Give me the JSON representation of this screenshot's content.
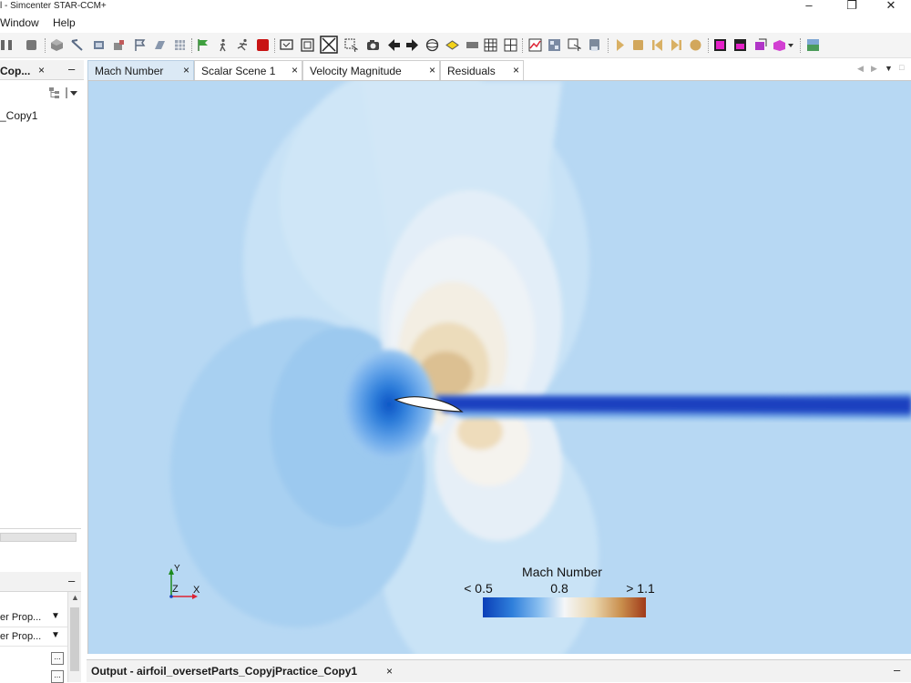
{
  "window": {
    "title": "l - Simcenter STAR-CCM+",
    "minimize_glyph": "–",
    "restore_glyph": "❐",
    "close_glyph": "✕"
  },
  "menu": {
    "items": [
      "Window",
      "Help"
    ]
  },
  "toolbar": {
    "icons": [
      "pause-icon",
      "stop-icon",
      "mesh-icon",
      "probe-icon",
      "region-icon",
      "boundary-icon",
      "flag-icon",
      "part-icon",
      "grid-icon",
      "flag-green-icon",
      "walk-icon",
      "run-icon",
      "stop-red-icon",
      "screen-icon",
      "fit-icon",
      "zoom-fit-icon",
      "select-icon",
      "camera-icon",
      "arrow-left-icon",
      "arrow-right-icon",
      "sphere-icon",
      "plane-icon",
      "ruler-icon",
      "table-icon",
      "table2-icon",
      "graph-icon",
      "windows-icon",
      "copy-icon",
      "save-icon",
      "play-icon",
      "square-icon",
      "step-back-icon",
      "step-fwd-icon",
      "record-icon",
      "scene-icon",
      "scene2-icon",
      "export-icon",
      "3d-icon",
      "view-icon"
    ]
  },
  "left_panel": {
    "title": "Cop...",
    "close_glyph": "×",
    "minimize_glyph": "–",
    "tree_item": "_Copy1",
    "bottom_minimize_glyph": "–",
    "properties": [
      {
        "label": "er Prop...",
        "dropdown": "▼"
      },
      {
        "label": "er Prop...",
        "dropdown": "▼"
      }
    ],
    "ellipsis": "..."
  },
  "tabs": [
    {
      "label": "Mach Number",
      "close": "×",
      "active": true
    },
    {
      "label": "Scalar Scene 1",
      "close": "×",
      "active": false
    },
    {
      "label": "Velocity Magnitude",
      "close": "×",
      "active": false
    },
    {
      "label": "Residuals",
      "close": "×",
      "active": false
    }
  ],
  "tab_nav": {
    "prev": "◀",
    "next": "▶",
    "menu": "▼",
    "max": "□"
  },
  "scene": {
    "axes": {
      "y": "Y",
      "z": "Z",
      "x": "X"
    },
    "legend": {
      "title": "Mach Number",
      "min_label": "< 0.5",
      "mid_label": "0.8",
      "max_label": "> 1.1"
    },
    "colors": {
      "background": "#b7d8f3",
      "wake": "#1f3fbf",
      "low_mach": "#0b52c4",
      "high_mach": "#d9b887",
      "airfoil": "#ffffff"
    }
  },
  "output": {
    "title": "Output - airfoil_oversetParts_CopyjPractice_Copy1",
    "close_glyph": "×",
    "minimize_glyph": "–"
  }
}
